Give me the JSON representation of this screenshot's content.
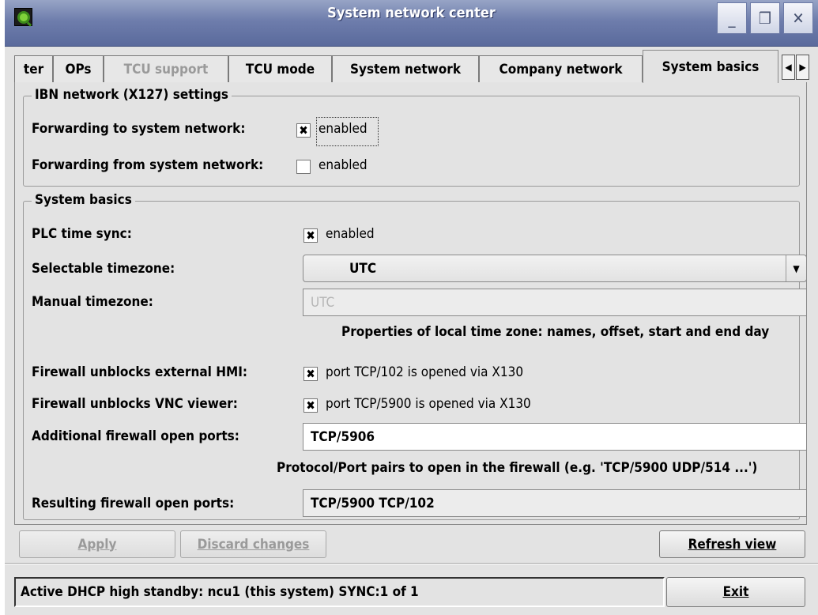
{
  "window": {
    "title": "System network center"
  },
  "titlebar": {
    "minimize": "_",
    "maximize": "❒",
    "close": "✕"
  },
  "tabs": [
    {
      "label": "ter",
      "state": "normal"
    },
    {
      "label": "OPs",
      "state": "normal"
    },
    {
      "label": "TCU support",
      "state": "disabled"
    },
    {
      "label": "TCU mode",
      "state": "normal"
    },
    {
      "label": "System network",
      "state": "normal"
    },
    {
      "label": "Company network",
      "state": "normal"
    },
    {
      "label": "System basics",
      "state": "active"
    }
  ],
  "tab_scroll": {
    "left": "◀",
    "right": "▶"
  },
  "ibn": {
    "legend": "IBN network (X127) settings",
    "forward_to_label": "Forwarding to system network:",
    "forward_to_checked": true,
    "forward_to_text": "enabled",
    "forward_from_label": "Forwarding from system network:",
    "forward_from_checked": false,
    "forward_from_text": "enabled"
  },
  "basics": {
    "legend": "System basics",
    "plc_label": "PLC time sync:",
    "plc_checked": true,
    "plc_text": "enabled",
    "tz_select_label": "Selectable timezone:",
    "tz_select_value": "UTC",
    "tz_manual_label": "Manual timezone:",
    "tz_manual_value": "UTC",
    "tz_hint": "Properties of local time zone: names, offset, start and end day",
    "fw_hmi_label": "Firewall unblocks external HMI:",
    "fw_hmi_checked": true,
    "fw_hmi_text": "port TCP/102 is opened via X130",
    "fw_vnc_label": "Firewall unblocks VNC viewer:",
    "fw_vnc_checked": true,
    "fw_vnc_text": "port TCP/5900 is opened via X130",
    "fw_add_label": "Additional firewall open ports:",
    "fw_add_value": "TCP/5906",
    "fw_hint": "Protocol/Port pairs to open in the firewall (e.g. 'TCP/5900 UDP/514 ...')",
    "fw_result_label": "Resulting firewall open ports:",
    "fw_result_value": "TCP/5900 TCP/102"
  },
  "buttons": {
    "apply": "Apply",
    "discard": "Discard changes",
    "refresh": "Refresh view",
    "exit": "Exit"
  },
  "status": {
    "text": "Active DHCP high standby: ncu1 (this system) SYNC:1 of 1"
  },
  "colors": {
    "titlebar": "#6e7dac",
    "window_bg": "#e3e3e3",
    "app_icon": "#7fd23a"
  }
}
